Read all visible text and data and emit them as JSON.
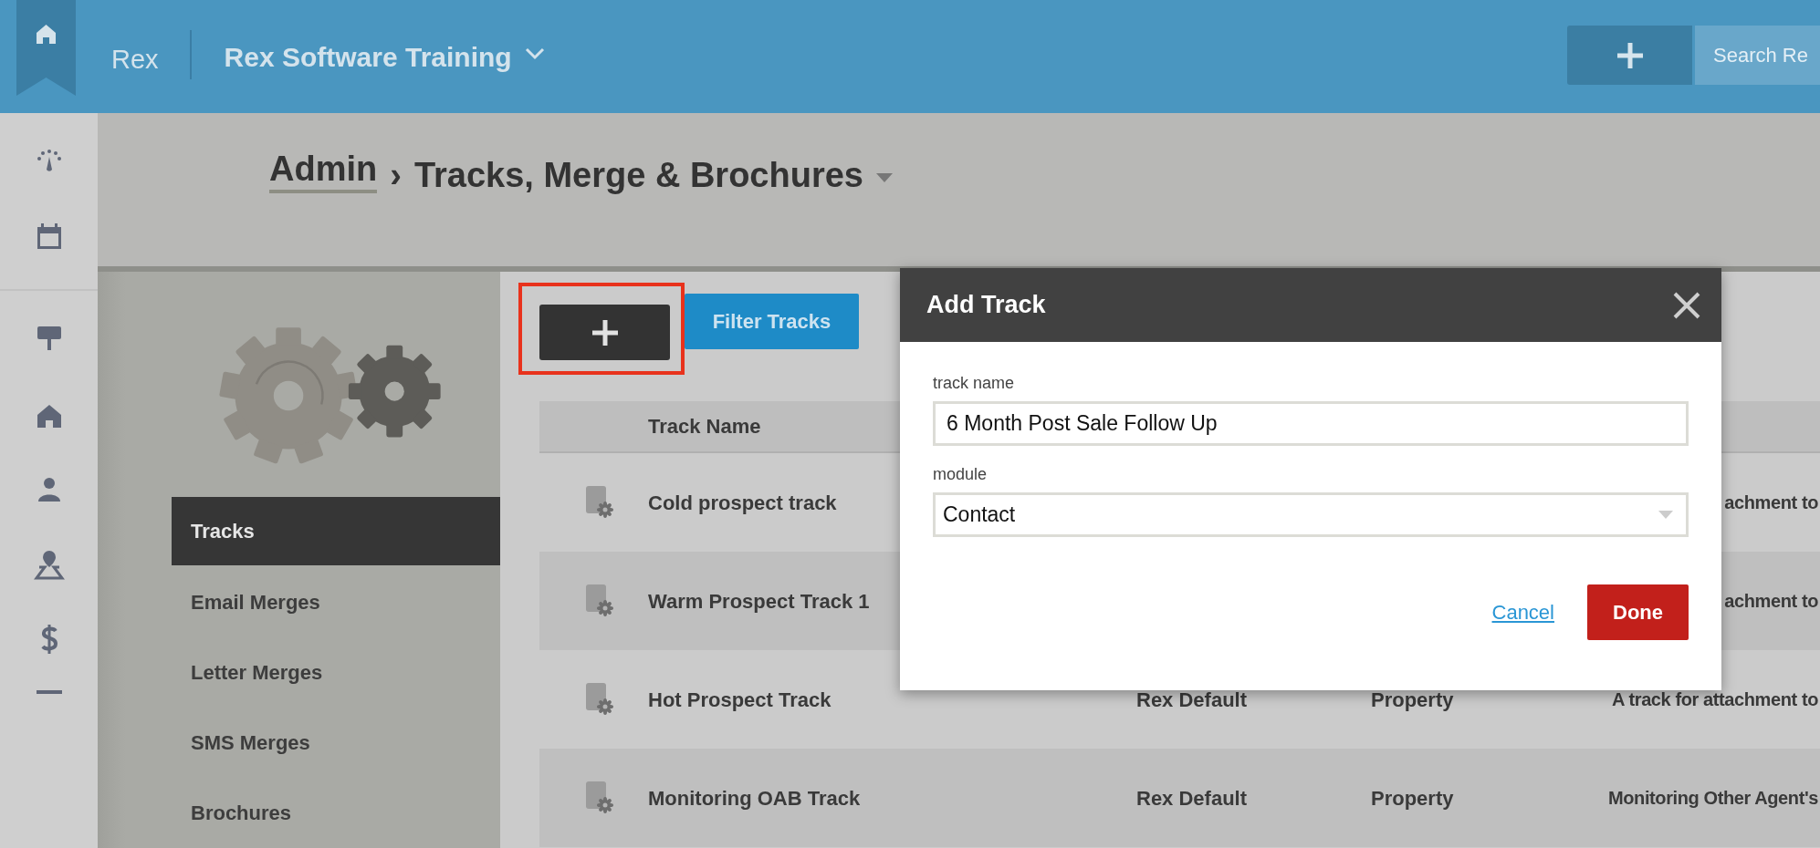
{
  "top_bar": {
    "brand": "Rex",
    "account": "Rex Software Training",
    "search": {
      "placeholder": "Search Re"
    }
  },
  "breadcrumb": {
    "parent": "Admin",
    "separator": "›",
    "current": "Tracks, Merge & Brochures"
  },
  "side_menu": [
    {
      "label": "Tracks",
      "selected": true
    },
    {
      "label": "Email Merges",
      "selected": false
    },
    {
      "label": "Letter Merges",
      "selected": false
    },
    {
      "label": "SMS Merges",
      "selected": false
    },
    {
      "label": "Brochures",
      "selected": false
    }
  ],
  "toolbar": {
    "filter_button": "Filter Tracks"
  },
  "table": {
    "columns": [
      "Track Name"
    ],
    "rows": [
      {
        "name": "Cold prospect track",
        "column_5": "achment to"
      },
      {
        "name": "Warm Prospect Track 1",
        "column_5": "achment to"
      },
      {
        "name": "Hot Prospect Track",
        "column_3": "Rex Default",
        "column_4": "Property",
        "column_5": "A track for attachment to"
      },
      {
        "name": "Monitoring OAB Track",
        "column_3": "Rex Default",
        "column_4": "Property",
        "column_5": "Monitoring Other Agent's"
      }
    ]
  },
  "modal": {
    "title": "Add Track",
    "fields": [
      {
        "label": "track name",
        "kind": "text",
        "value": "6 Month Post Sale Follow Up"
      },
      {
        "label": "module",
        "kind": "select",
        "value": "Contact"
      }
    ],
    "cancel": "Cancel",
    "done": "Done"
  }
}
